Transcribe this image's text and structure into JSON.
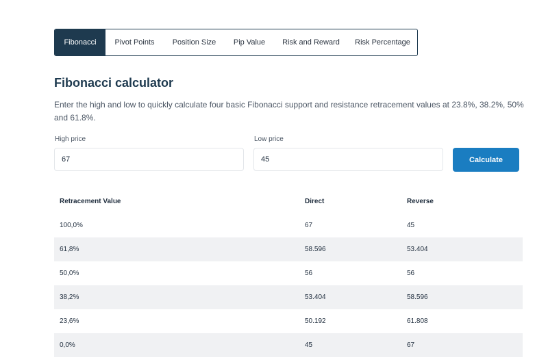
{
  "tabs": [
    {
      "label": "Fibonacci",
      "active": true
    },
    {
      "label": "Pivot Points",
      "active": false
    },
    {
      "label": "Position Size",
      "active": false
    },
    {
      "label": "Pip Value",
      "active": false
    },
    {
      "label": "Risk and Reward",
      "active": false
    },
    {
      "label": "Risk Percentage",
      "active": false
    }
  ],
  "title": "Fibonacci calculator",
  "description": "Enter the high and low to quickly calculate four basic Fibonacci support and resistance retracement values at 23.8%, 38.2%, 50% and 61.8%.",
  "form": {
    "high_label": "High price",
    "high_value": "67",
    "low_label": "Low price",
    "low_value": "45",
    "calculate_label": "Calculate"
  },
  "colors": {
    "accent": "#1a7dc1",
    "tab_active": "#1e3a4f",
    "row_stripe": "#f0f1f3"
  },
  "table": {
    "headers": [
      "Retracement Value",
      "Direct",
      "Reverse"
    ],
    "rows": [
      [
        "100,0%",
        "67",
        "45"
      ],
      [
        "61,8%",
        "58.596",
        "53.404"
      ],
      [
        "50,0%",
        "56",
        "56"
      ],
      [
        "38,2%",
        "53.404",
        "58.596"
      ],
      [
        "23,6%",
        "50.192",
        "61.808"
      ],
      [
        "0,0%",
        "45",
        "67"
      ]
    ]
  }
}
